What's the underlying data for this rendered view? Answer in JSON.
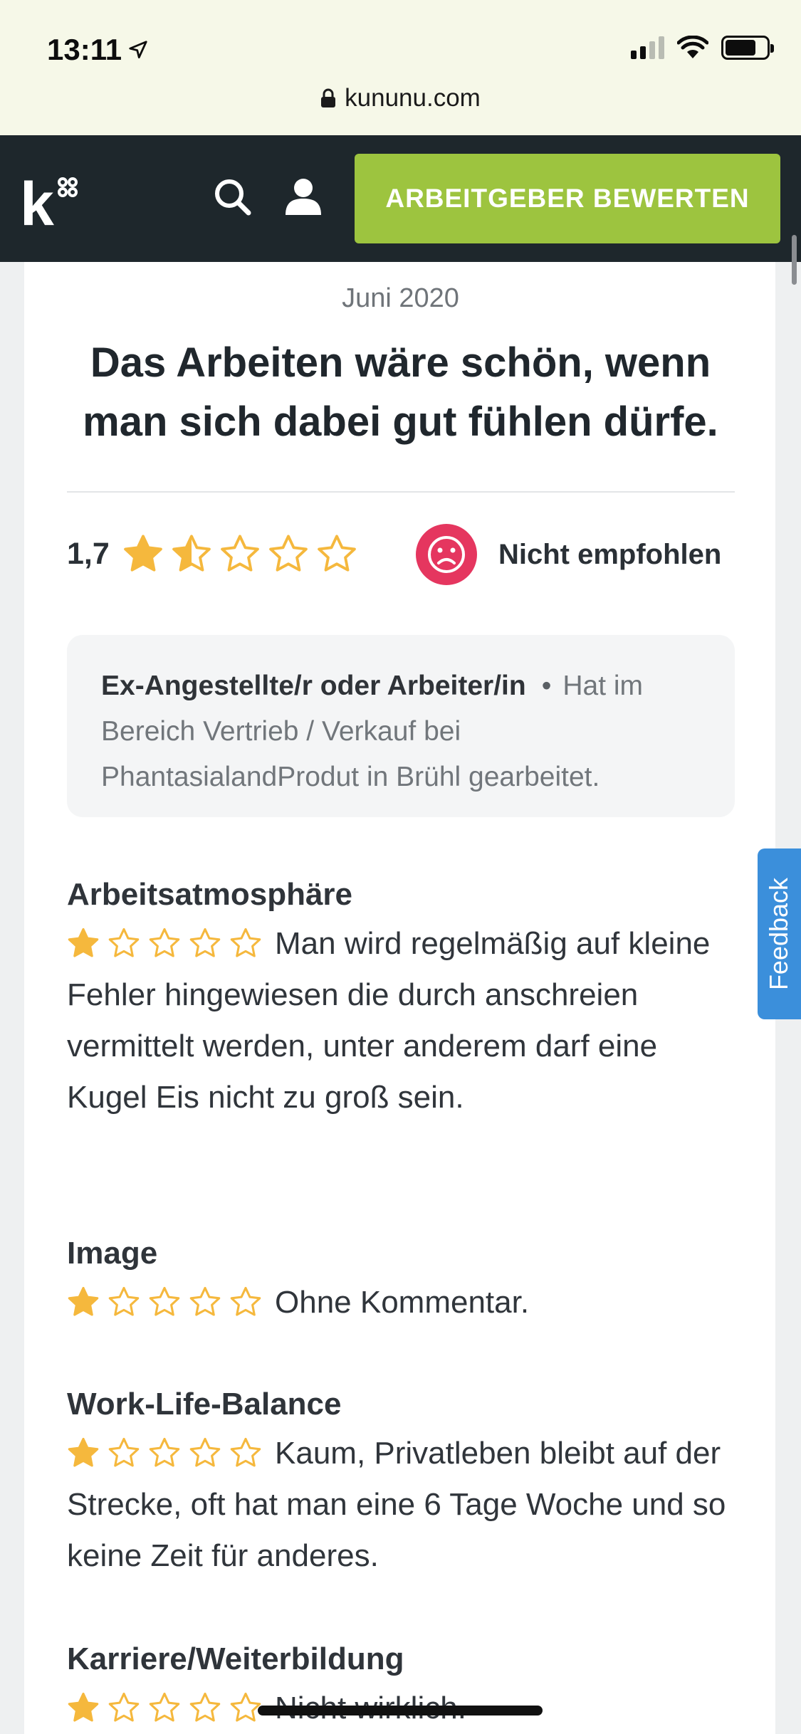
{
  "status_bar": {
    "time": "13:11",
    "url": "kununu.com"
  },
  "nav": {
    "logo": "k",
    "cta_label": "ARBEITGEBER BEWERTEN",
    "colors": {
      "background": "#1e272c",
      "cta": "#9dc43f"
    }
  },
  "review": {
    "date": "Juni 2020",
    "title": "Das Arbeiten wäre schön, wenn man sich dabei gut fühlen dürfe.",
    "score": "1,7",
    "score_stars": 1.5,
    "recommendation": "Nicht empfohlen",
    "author": {
      "role": "Ex-Angestellte/r oder Arbeiter/in",
      "separator": "•",
      "detail": "Hat im Bereich Vertrieb / Verkauf bei PhantasialandProdut in Brühl gearbeitet."
    },
    "categories": [
      {
        "name": "Arbeitsatmosphäre",
        "stars": 1,
        "text": "Man wird regelmäßig auf kleine Fehler hingewiesen die durch anschreien vermittelt werden, unter anderem darf eine Kugel Eis nicht zu groß sein."
      },
      {
        "name": "Image",
        "stars": 1,
        "text": "Ohne Kommentar."
      },
      {
        "name": "Work-Life-Balance",
        "stars": 1,
        "text": "Kaum, Privatleben bleibt auf der Strecke, oft hat man eine 6 Tage Woche und so keine Zeit für anderes."
      },
      {
        "name": "Karriere/Weiterbildung",
        "stars": 1,
        "text": "Nicht wirklich."
      }
    ]
  },
  "feedback_tab": "Feedback",
  "colors": {
    "star": "#f5b83d",
    "negative": "#e5365f",
    "feedback": "#3b8fdb"
  }
}
